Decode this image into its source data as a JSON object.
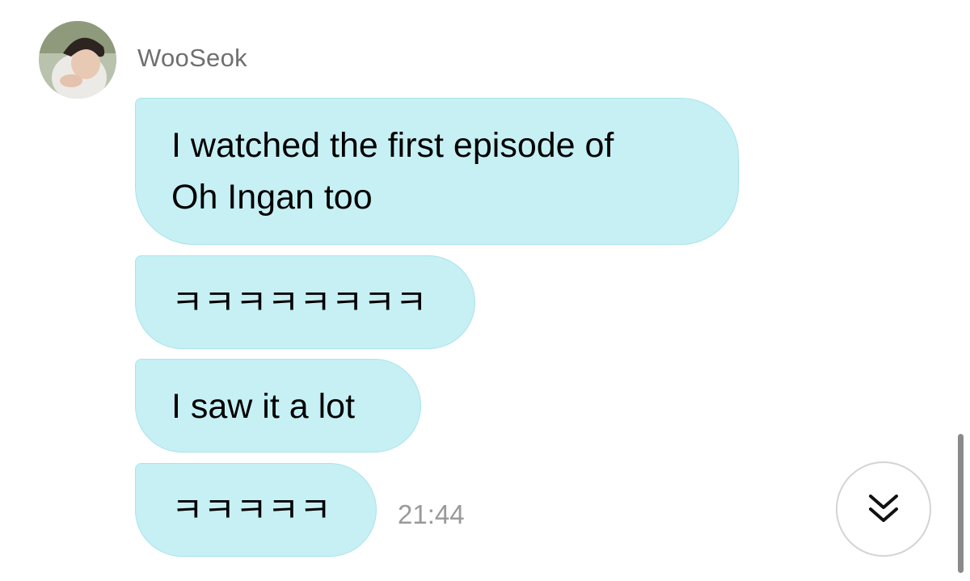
{
  "chat": {
    "sender": {
      "name": "WooSeok",
      "avatar_icon": "profile-photo"
    },
    "messages": [
      {
        "lines": [
          "I watched the first episode of",
          "Oh Ingan too"
        ]
      },
      {
        "lines": [
          "ㅋㅋㅋㅋㅋㅋㅋㅋ"
        ]
      },
      {
        "lines": [
          "I saw it a lot"
        ]
      },
      {
        "lines": [
          "ㅋㅋㅋㅋㅋ"
        ]
      }
    ],
    "timestamp": "21:44",
    "scroll_down_icon": "double-chevron-down-icon"
  },
  "colors": {
    "bubble": "#c6f0f4",
    "bubble_border": "#a9e3ea",
    "name": "#6f6f6f",
    "timestamp": "#9a9a9a"
  }
}
